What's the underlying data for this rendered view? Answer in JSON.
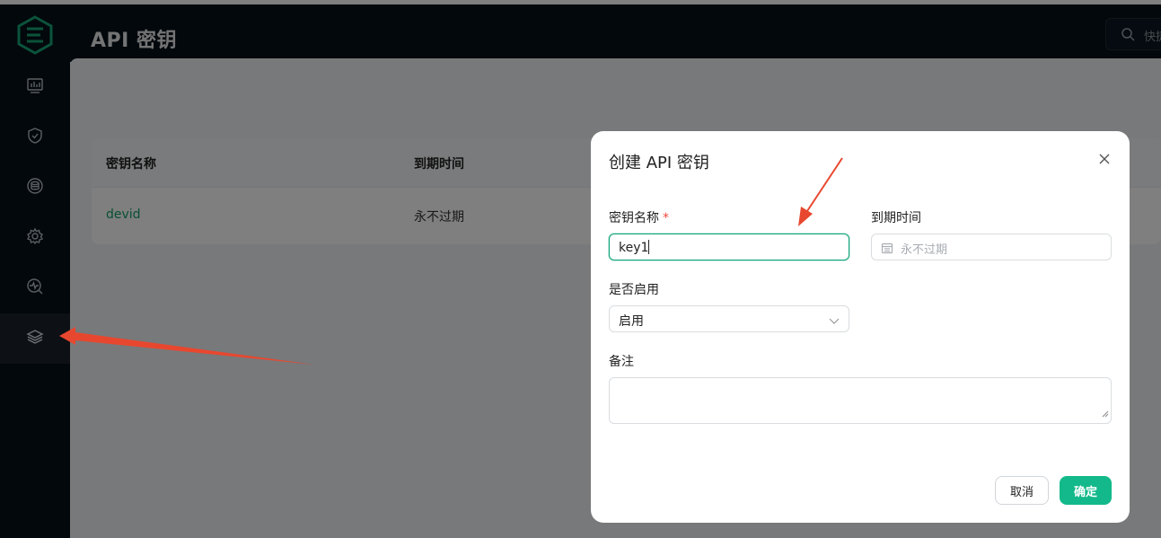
{
  "header": {
    "title": "API 密钥",
    "search_placeholder": "快捷"
  },
  "sidebar": {
    "items": [
      {
        "icon": "dashboard-chart-icon"
      },
      {
        "icon": "shield-icon"
      },
      {
        "icon": "database-icon"
      },
      {
        "icon": "settings-gear-icon"
      },
      {
        "icon": "monitor-search-icon"
      },
      {
        "icon": "layers-icon",
        "active": true
      }
    ]
  },
  "table": {
    "columns": [
      "密钥名称",
      "到期时间"
    ],
    "rows": [
      {
        "name": "devid",
        "expiry": "永不过期"
      }
    ]
  },
  "dialog": {
    "title": "创建 API 密钥",
    "name_label": "密钥名称",
    "required_mark": "*",
    "name_value": "key1",
    "expiry_label": "到期时间",
    "expiry_placeholder": "永不过期",
    "enabled_label": "是否启用",
    "enabled_value": "启用",
    "remark_label": "备注",
    "remark_value": "",
    "cancel_label": "取消",
    "ok_label": "确定"
  },
  "colors": {
    "accent": "#13b98a",
    "sidebar_bg": "#041019",
    "annotation_red": "#e8472f"
  }
}
